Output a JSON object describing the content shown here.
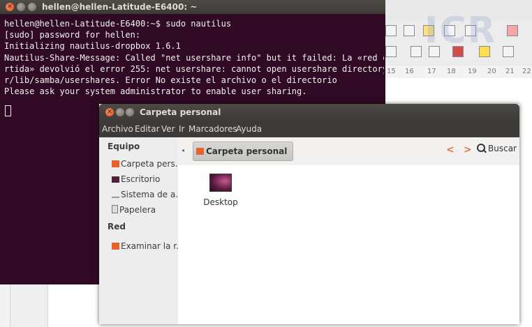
{
  "terminal": {
    "title": "hellen@hellen-Latitude-E6400: ~",
    "lines": [
      "hellen@hellen-Latitude-E6400:~$ sudo nautilus",
      "[sudo] password for hellen:",
      "Initializing nautilus-dropbox 1.6.1",
      "Nautilus-Share-Message: Called \"net usershare info\" but it failed: La «red compa",
      "rtida» devolvió el error 255: net usershare: cannot open usershare directory /va",
      "r/lib/samba/usershares. Error No existe el archivo o el directorio",
      "Please ask your system administrator to enable user sharing."
    ]
  },
  "writer": {
    "logo_text": "ICR",
    "ruler_numbers": [
      "15",
      "16",
      "17",
      "18",
      "19",
      "20",
      "21",
      "22"
    ]
  },
  "nautilus": {
    "title": "Carpeta personal",
    "menu": [
      "Archivo",
      "Editar",
      "Ver",
      "Ir",
      "Marcadores",
      "Ayuda"
    ],
    "sidebar": {
      "section_equipo": "Equipo",
      "section_red": "Red",
      "items": [
        {
          "label": "Carpeta pers...",
          "icon": "home-folder-icon"
        },
        {
          "label": "Escritorio",
          "icon": "desktop-icon"
        },
        {
          "label": "Sistema de a...",
          "icon": "filesystem-icon"
        },
        {
          "label": "Papelera",
          "icon": "trash-icon"
        }
      ],
      "network_items": [
        {
          "label": "Examinar la r...",
          "icon": "network-icon"
        }
      ]
    },
    "breadcrumb": "Carpeta personal",
    "search_label": "Buscar",
    "files": [
      {
        "name": "Desktop",
        "icon": "desktop-folder-icon"
      }
    ]
  }
}
